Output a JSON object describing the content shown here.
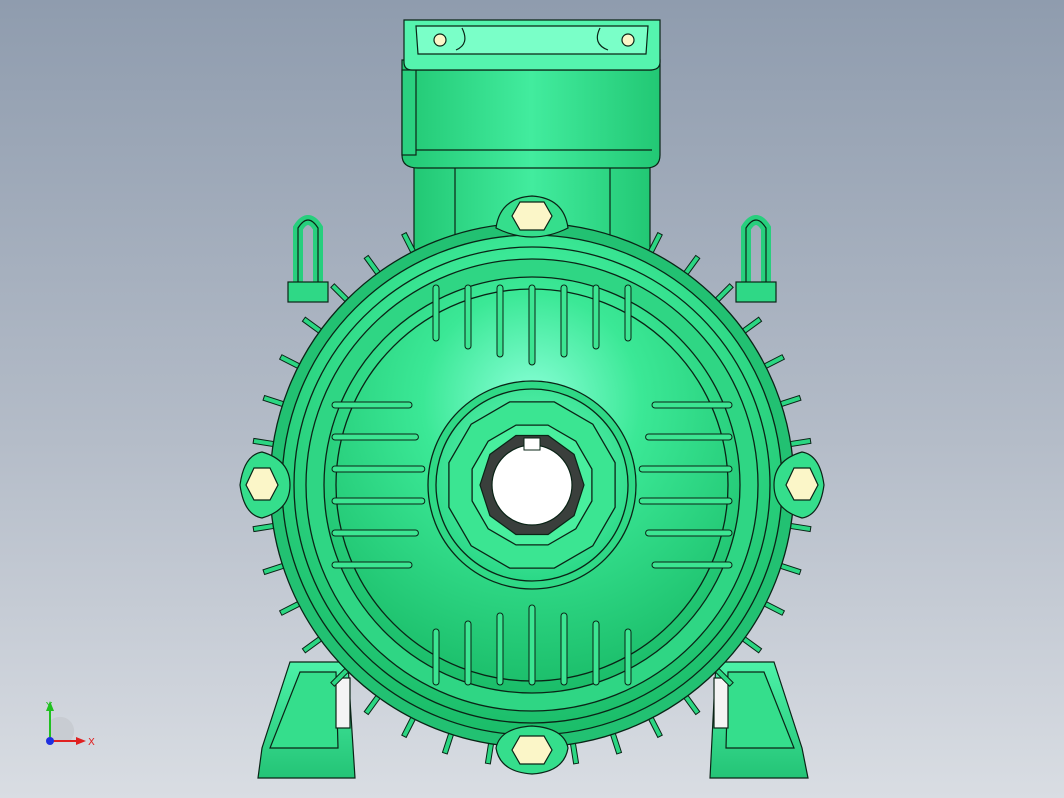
{
  "viewport": {
    "background_top": "#8f9cae",
    "background_bottom": "#d9dde3",
    "model": {
      "body_color": "#33e08a",
      "highlight_color": "#7affc8",
      "edge_color": "#0a2416",
      "bolt_color": "#fbf6c8"
    }
  },
  "triad": {
    "x_label": "X",
    "y_label": "Y",
    "x_color": "#e02020",
    "y_color": "#20c020",
    "z_color": "#2030e0"
  }
}
